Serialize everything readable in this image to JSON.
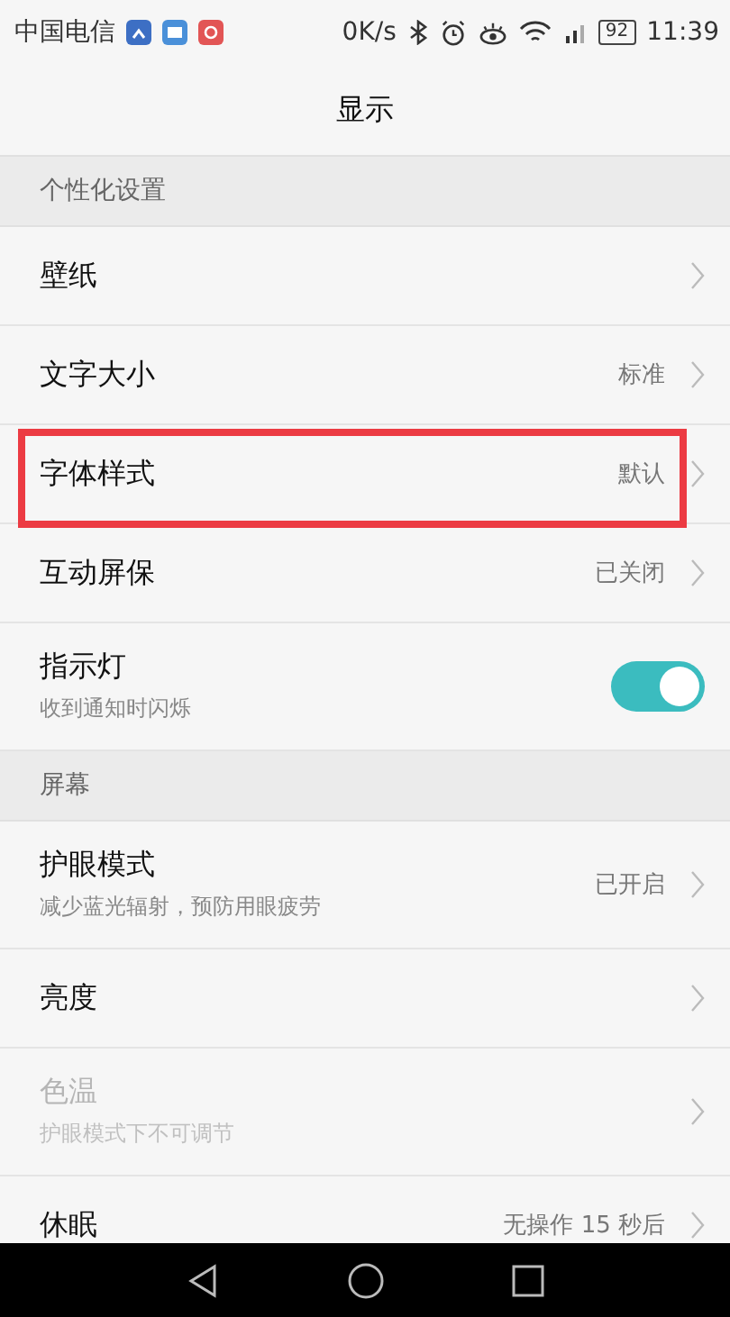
{
  "status_bar": {
    "carrier": "中国电信",
    "speed": "0K/s",
    "battery": "92",
    "time": "11:39"
  },
  "title": "显示",
  "sections": [
    {
      "header": "个性化设置",
      "rows": [
        {
          "kind": "link",
          "label": "壁纸",
          "disabled": false,
          "highlighted": false
        },
        {
          "kind": "link",
          "label": "文字大小",
          "value": "标准",
          "disabled": false,
          "highlighted": false
        },
        {
          "kind": "link",
          "label": "字体样式",
          "value": "默认",
          "disabled": false,
          "highlighted": true
        },
        {
          "kind": "link",
          "label": "互动屏保",
          "value": "已关闭",
          "disabled": false,
          "highlighted": false
        },
        {
          "kind": "toggle",
          "label": "指示灯",
          "subtitle": "收到通知时闪烁",
          "on": true,
          "disabled": false,
          "highlighted": false
        }
      ]
    },
    {
      "header": "屏幕",
      "rows": [
        {
          "kind": "link",
          "label": "护眼模式",
          "subtitle": "减少蓝光辐射，预防用眼疲劳",
          "value": "已开启",
          "disabled": false,
          "highlighted": false
        },
        {
          "kind": "link",
          "label": "亮度",
          "disabled": false,
          "highlighted": false
        },
        {
          "kind": "link",
          "label": "色温",
          "subtitle": "护眼模式下不可调节",
          "disabled": true,
          "highlighted": false
        },
        {
          "kind": "link",
          "label": "休眠",
          "value": "无操作 15 秒后",
          "disabled": false,
          "highlighted": false
        }
      ]
    }
  ]
}
